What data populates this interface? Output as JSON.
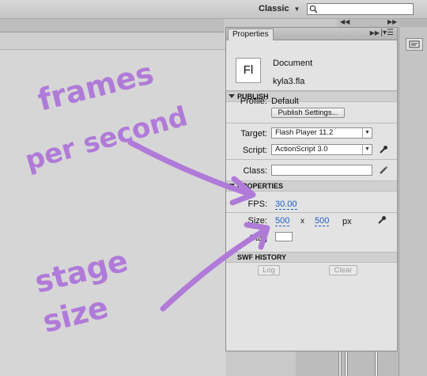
{
  "topbar": {
    "workspace": "Classic"
  },
  "panel": {
    "tab_label": "Properties",
    "document": {
      "icon_text": "Fl",
      "type": "Document",
      "name": "kyla3.fla"
    },
    "publish": {
      "heading": "PUBLISH",
      "profile_label": "Profile:",
      "profile_value": "Default",
      "publish_settings_button": "Publish Settings...",
      "target_label": "Target:",
      "target_value": "Flash Player 11.2",
      "script_label": "Script:",
      "script_value": "ActionScript 3.0",
      "class_label": "Class:",
      "class_value": ""
    },
    "properties": {
      "heading": "PROPERTIES",
      "fps_label": "FPS:",
      "fps_value": "30.00",
      "size_label": "Size:",
      "width": "500",
      "x_label": "x",
      "height": "500",
      "unit": "px",
      "stage_label": "Stag",
      "stage_color": "#ffffff"
    },
    "swf_history": {
      "heading": "SWF HISTORY",
      "log_button": "Log",
      "clear_button": "Clear"
    }
  },
  "annotations": {
    "frames_line1": "frames",
    "frames_line2": "per second",
    "stage_line1": "stage",
    "stage_line2": "size",
    "ink_color": "#b07ad9"
  }
}
